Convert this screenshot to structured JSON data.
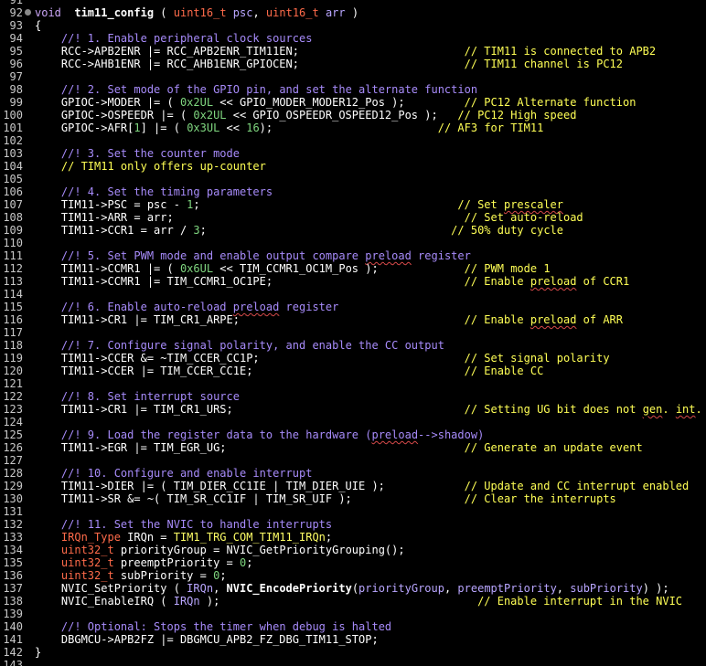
{
  "colors": {
    "background": "#000000",
    "line_number": "#c8c8c8",
    "default_text": "#ffffff",
    "keyword": "#c9a4f5",
    "type": "#ff6b4a",
    "function_name": "#ffffff",
    "macro": "#ffff66",
    "number": "#7fd67f",
    "parameter": "#b9a6ff",
    "doc_comment": "#a78bfa",
    "line_comment": "#ffff55",
    "spell_squiggle": "#d84a4a"
  },
  "fold_marker_line": "92",
  "lines": [
    {
      "n": "91",
      "segs": []
    },
    {
      "n": "92",
      "segs": [
        [
          "kw",
          "void"
        ],
        [
          "",
          "  "
        ],
        [
          "fn",
          "tim11_config"
        ],
        [
          "",
          " ( "
        ],
        [
          "ty",
          "uint16_t"
        ],
        [
          "",
          " "
        ],
        [
          "pm",
          "psc"
        ],
        [
          "",
          ", "
        ],
        [
          "ty",
          "uint16_t"
        ],
        [
          "",
          " "
        ],
        [
          "pm",
          "arr"
        ],
        [
          "",
          " )"
        ]
      ]
    },
    {
      "n": "93",
      "segs": [
        [
          "",
          "{"
        ]
      ]
    },
    {
      "n": "94",
      "segs": [
        [
          "",
          "    "
        ],
        [
          "cm",
          "//! 1. Enable peripheral clock sources"
        ]
      ]
    },
    {
      "n": "95",
      "segs": [
        [
          "",
          "    RCC->APB2ENR |= RCC_APB2ENR_TIM11EN;                         "
        ],
        [
          "cy",
          "// TIM11 is connected to APB2"
        ]
      ]
    },
    {
      "n": "96",
      "segs": [
        [
          "",
          "    RCC->AHB1ENR |= RCC_AHB1ENR_GPIOCEN;                         "
        ],
        [
          "cy",
          "// TIM11 channel is PC12"
        ]
      ]
    },
    {
      "n": "97",
      "segs": []
    },
    {
      "n": "98",
      "segs": [
        [
          "",
          "    "
        ],
        [
          "cm",
          "//! 2. Set mode of the GPIO pin, and set the alternate function"
        ]
      ]
    },
    {
      "n": "99",
      "segs": [
        [
          "",
          "    GPIOC->MODER |= ( "
        ],
        [
          "num",
          "0x2UL"
        ],
        [
          "",
          " << GPIO_MODER_MODER12_Pos );         "
        ],
        [
          "cy",
          "// PC12 Alternate function"
        ]
      ]
    },
    {
      "n": "100",
      "segs": [
        [
          "",
          "    GPIOC->OSPEEDR |= ( "
        ],
        [
          "num",
          "0x2UL"
        ],
        [
          "",
          " << GPIO_OSPEEDR_OSPEED12_Pos );   "
        ],
        [
          "cy",
          "// PC12 High speed"
        ]
      ]
    },
    {
      "n": "101",
      "segs": [
        [
          "",
          "    GPIOC->AFR["
        ],
        [
          "num",
          "1"
        ],
        [
          "",
          "] |= ( "
        ],
        [
          "num",
          "0x3UL"
        ],
        [
          "",
          " << "
        ],
        [
          "num",
          "16"
        ],
        [
          "",
          ");                         "
        ],
        [
          "cy",
          "// AF3 for TIM11"
        ]
      ]
    },
    {
      "n": "102",
      "segs": []
    },
    {
      "n": "103",
      "segs": [
        [
          "",
          "    "
        ],
        [
          "cm",
          "//! 3. Set the counter mode"
        ]
      ]
    },
    {
      "n": "104",
      "segs": [
        [
          "",
          "    "
        ],
        [
          "cy",
          "// TIM11 only offers up-counter"
        ]
      ]
    },
    {
      "n": "105",
      "segs": []
    },
    {
      "n": "106",
      "segs": [
        [
          "",
          "    "
        ],
        [
          "cm",
          "//! 4. Set the timing parameters"
        ]
      ]
    },
    {
      "n": "107",
      "segs": [
        [
          "",
          "    TIM11->PSC = psc - "
        ],
        [
          "num",
          "1"
        ],
        [
          "",
          ";                                       "
        ],
        [
          "cy",
          "// Set "
        ],
        [
          "cysq",
          "prescaler"
        ]
      ]
    },
    {
      "n": "108",
      "segs": [
        [
          "",
          "    TIM11->ARR = arr;                                            "
        ],
        [
          "cy",
          "// Set auto-reload"
        ]
      ]
    },
    {
      "n": "109",
      "segs": [
        [
          "",
          "    TIM11->CCR1 = arr / "
        ],
        [
          "num",
          "3"
        ],
        [
          "",
          ";                                     "
        ],
        [
          "cy",
          "// 50% duty cycle"
        ]
      ]
    },
    {
      "n": "110",
      "segs": []
    },
    {
      "n": "111",
      "segs": [
        [
          "",
          "    "
        ],
        [
          "cm",
          "//! 5. Set PWM mode and enable output compare "
        ],
        [
          "cmsq",
          "preload"
        ],
        [
          "cm",
          " register"
        ]
      ]
    },
    {
      "n": "112",
      "segs": [
        [
          "",
          "    TIM11->CCMR1 |= ( "
        ],
        [
          "num",
          "0x6UL"
        ],
        [
          "",
          " << TIM_CCMR1_OC1M_Pos );             "
        ],
        [
          "cy",
          "// PWM mode 1"
        ]
      ]
    },
    {
      "n": "113",
      "segs": [
        [
          "",
          "    TIM11->CCMR1 |= TIM_CCMR1_OC1PE;                             "
        ],
        [
          "cy",
          "// Enable "
        ],
        [
          "cysq",
          "preload"
        ],
        [
          "cy",
          " of CCR1"
        ]
      ]
    },
    {
      "n": "114",
      "segs": []
    },
    {
      "n": "115",
      "segs": [
        [
          "",
          "    "
        ],
        [
          "cm",
          "//! 6. Enable auto-reload "
        ],
        [
          "cmsq",
          "preload"
        ],
        [
          "cm",
          " register"
        ]
      ]
    },
    {
      "n": "116",
      "segs": [
        [
          "",
          "    TIM11->CR1 |= TIM_CR1_ARPE;                                  "
        ],
        [
          "cy",
          "// Enable "
        ],
        [
          "cysq",
          "preload"
        ],
        [
          "cy",
          " of ARR"
        ]
      ]
    },
    {
      "n": "117",
      "segs": []
    },
    {
      "n": "118",
      "segs": [
        [
          "",
          "    "
        ],
        [
          "cm",
          "//! 7. Configure signal polarity, and enable the CC output"
        ]
      ]
    },
    {
      "n": "119",
      "segs": [
        [
          "",
          "    TIM11->CCER &= ~TIM_CCER_CC1P;                               "
        ],
        [
          "cy",
          "// Set signal polarity"
        ]
      ]
    },
    {
      "n": "120",
      "segs": [
        [
          "",
          "    TIM11->CCER |= TIM_CCER_CC1E;                                "
        ],
        [
          "cy",
          "// Enable CC"
        ]
      ]
    },
    {
      "n": "121",
      "segs": []
    },
    {
      "n": "122",
      "segs": [
        [
          "",
          "    "
        ],
        [
          "cm",
          "//! 8. Set interrupt source"
        ]
      ]
    },
    {
      "n": "123",
      "segs": [
        [
          "",
          "    TIM11->CR1 |= TIM_CR1_URS;                                   "
        ],
        [
          "cy",
          "// Setting UG bit does not "
        ],
        [
          "cysq",
          "gen"
        ],
        [
          "cy",
          ". "
        ],
        [
          "cysq",
          "int"
        ],
        [
          "cy",
          "."
        ]
      ]
    },
    {
      "n": "124",
      "segs": []
    },
    {
      "n": "125",
      "segs": [
        [
          "",
          "    "
        ],
        [
          "cm",
          "//! 9. Load the register data to the hardware ("
        ],
        [
          "cmsq",
          "preload"
        ],
        [
          "cm",
          "-->shadow)"
        ]
      ]
    },
    {
      "n": "126",
      "segs": [
        [
          "",
          "    TIM11->EGR |= TIM_EGR_UG;                                    "
        ],
        [
          "cy",
          "// Generate an update event"
        ]
      ]
    },
    {
      "n": "127",
      "segs": []
    },
    {
      "n": "128",
      "segs": [
        [
          "",
          "    "
        ],
        [
          "cm",
          "//! 10. Configure and enable interrupt"
        ]
      ]
    },
    {
      "n": "129",
      "segs": [
        [
          "",
          "    TIM11->DIER |= ( TIM_DIER_CC1IE | TIM_DIER_UIE );            "
        ],
        [
          "cy",
          "// Update and CC interrupt enabled"
        ]
      ]
    },
    {
      "n": "130",
      "segs": [
        [
          "",
          "    TIM11->SR &= ~( TIM_SR_CC1IF | TIM_SR_UIF );                 "
        ],
        [
          "cy",
          "// Clear the interrupts"
        ]
      ]
    },
    {
      "n": "131",
      "segs": []
    },
    {
      "n": "132",
      "segs": [
        [
          "",
          "    "
        ],
        [
          "cm",
          "//! 11. Set the NVIC to handle interrupts"
        ]
      ]
    },
    {
      "n": "133",
      "segs": [
        [
          "",
          "    "
        ],
        [
          "ty",
          "IRQn_Type"
        ],
        [
          "",
          " IRQn = "
        ],
        [
          "mac",
          "TIM1_TRG_COM_TIM11_IRQn"
        ],
        [
          "",
          ";"
        ]
      ]
    },
    {
      "n": "134",
      "segs": [
        [
          "",
          "    "
        ],
        [
          "ty",
          "uint32_t"
        ],
        [
          "",
          " priorityGroup = NVIC_GetPriorityGrouping();"
        ]
      ]
    },
    {
      "n": "135",
      "segs": [
        [
          "",
          "    "
        ],
        [
          "ty",
          "uint32_t"
        ],
        [
          "",
          " preemptPriority = "
        ],
        [
          "num",
          "0"
        ],
        [
          "",
          ";"
        ]
      ]
    },
    {
      "n": "136",
      "segs": [
        [
          "",
          "    "
        ],
        [
          "ty",
          "uint32_t"
        ],
        [
          "",
          " subPriority = "
        ],
        [
          "num",
          "0"
        ],
        [
          "",
          ";"
        ]
      ]
    },
    {
      "n": "137",
      "segs": [
        [
          "",
          "    NVIC_SetPriority ( "
        ],
        [
          "pm",
          "IRQn"
        ],
        [
          "",
          ", "
        ],
        [
          "fn",
          "NVIC_EncodePriority"
        ],
        [
          "",
          "("
        ],
        [
          "pm",
          "priorityGroup"
        ],
        [
          "",
          ", "
        ],
        [
          "pm",
          "preemptPriority"
        ],
        [
          "",
          ", "
        ],
        [
          "pm",
          "subPriority"
        ],
        [
          "",
          ") );"
        ]
      ]
    },
    {
      "n": "138",
      "segs": [
        [
          "",
          "    NVIC_EnableIRQ ( "
        ],
        [
          "pm",
          "IRQn"
        ],
        [
          "",
          " );                                       "
        ],
        [
          "cy",
          "// Enable interrupt in the NVIC"
        ]
      ]
    },
    {
      "n": "139",
      "segs": []
    },
    {
      "n": "140",
      "segs": [
        [
          "",
          "    "
        ],
        [
          "cm",
          "//! Optional: Stops the timer when debug is halted"
        ]
      ]
    },
    {
      "n": "141",
      "segs": [
        [
          "",
          "    DBGMCU->APB2FZ |= DBGMCU_APB2_FZ_DBG_TIM11_STOP;"
        ]
      ]
    },
    {
      "n": "142",
      "segs": [
        [
          "",
          "}"
        ]
      ]
    },
    {
      "n": "143",
      "segs": []
    }
  ]
}
